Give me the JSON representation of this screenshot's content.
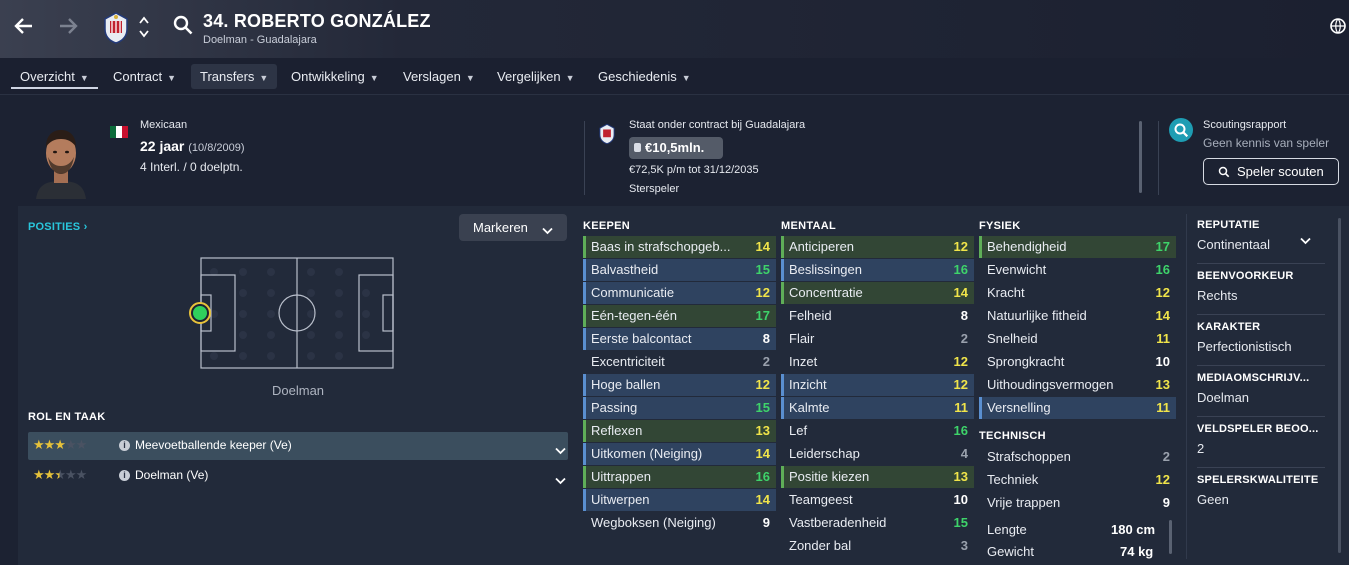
{
  "player": {
    "title": "34. ROBERTO GONZÁLEZ",
    "subtitle": "Doelman - Guadalajara"
  },
  "nav": [
    {
      "label": "Overzicht",
      "key": "overzicht"
    },
    {
      "label": "Contract",
      "key": "contract"
    },
    {
      "label": "Transfers",
      "key": "transfers"
    },
    {
      "label": "Ontwikkeling",
      "key": "ontwikkeling"
    },
    {
      "label": "Verslagen",
      "key": "verslagen"
    },
    {
      "label": "Vergelijken",
      "key": "vergelijken"
    },
    {
      "label": "Geschiedenis",
      "key": "geschiedenis"
    }
  ],
  "info": {
    "nationality": "Mexicaan",
    "age": "22 jaar",
    "birth": "(10/8/2009)",
    "caps": "4 Interl. / 0 doelptn."
  },
  "contract": {
    "status": "Staat onder contract bij Guadalajara",
    "value": "€10,5mln.",
    "wage": "€72,5K p/m tot 31/12/2035",
    "role": "Sterspeler"
  },
  "scout": {
    "title": "Scoutingsrapport",
    "subtitle": "Geen kennis van speler",
    "button": "Speler scouten"
  },
  "positions": {
    "header": "POSITIES",
    "dropdown": "Markeren",
    "position_label": "Doelman"
  },
  "roles": {
    "header": "ROL EN TAAK",
    "items": [
      {
        "name": "Meevoetballende keeper (Ve)",
        "stars": 3
      },
      {
        "name": "Doelman (Ve)",
        "stars": 2.5
      }
    ]
  },
  "keepen": {
    "header": "KEEPEN",
    "items": [
      {
        "n": "Baas in strafschopgeb...",
        "v": "14"
      },
      {
        "n": "Balvastheid",
        "v": "15"
      },
      {
        "n": "Communicatie",
        "v": "12"
      },
      {
        "n": "Eén-tegen-één",
        "v": "17"
      },
      {
        "n": "Eerste balcontact",
        "v": "8"
      },
      {
        "n": "Excentriciteit",
        "v": "2"
      },
      {
        "n": "Hoge ballen",
        "v": "12"
      },
      {
        "n": "Passing",
        "v": "15"
      },
      {
        "n": "Reflexen",
        "v": "13"
      },
      {
        "n": "Uitkomen (Neiging)",
        "v": "14"
      },
      {
        "n": "Uittrappen",
        "v": "16"
      },
      {
        "n": "Uitwerpen",
        "v": "14"
      },
      {
        "n": "Wegboksen (Neiging)",
        "v": "9"
      }
    ]
  },
  "mentaal": {
    "header": "MENTAAL",
    "items": [
      {
        "n": "Anticiperen",
        "v": "12"
      },
      {
        "n": "Beslissingen",
        "v": "16"
      },
      {
        "n": "Concentratie",
        "v": "14"
      },
      {
        "n": "Felheid",
        "v": "8"
      },
      {
        "n": "Flair",
        "v": "2"
      },
      {
        "n": "Inzet",
        "v": "12"
      },
      {
        "n": "Inzicht",
        "v": "12"
      },
      {
        "n": "Kalmte",
        "v": "11"
      },
      {
        "n": "Lef",
        "v": "16"
      },
      {
        "n": "Leiderschap",
        "v": "4"
      },
      {
        "n": "Positie kiezen",
        "v": "13"
      },
      {
        "n": "Teamgeest",
        "v": "10"
      },
      {
        "n": "Vastberadenheid",
        "v": "15"
      },
      {
        "n": "Zonder bal",
        "v": "3"
      }
    ]
  },
  "fysiek": {
    "header": "FYSIEK",
    "items": [
      {
        "n": "Behendigheid",
        "v": "17"
      },
      {
        "n": "Evenwicht",
        "v": "16"
      },
      {
        "n": "Kracht",
        "v": "12"
      },
      {
        "n": "Natuurlijke fitheid",
        "v": "14"
      },
      {
        "n": "Snelheid",
        "v": "11"
      },
      {
        "n": "Sprongkracht",
        "v": "10"
      },
      {
        "n": "Uithoudingsvermogen",
        "v": "13"
      },
      {
        "n": "Versnelling",
        "v": "11"
      }
    ]
  },
  "technisch": {
    "header": "TECHNISCH",
    "items": [
      {
        "n": "Strafschoppen",
        "v": "2"
      },
      {
        "n": "Techniek",
        "v": "12"
      },
      {
        "n": "Vrije trappen",
        "v": "9"
      }
    ]
  },
  "physical": {
    "length_label": "Lengte",
    "length": "180 cm",
    "weight_label": "Gewicht",
    "weight": "74 kg"
  },
  "side": [
    {
      "h": "REPUTATIE",
      "v": "Continentaal"
    },
    {
      "h": "BEENVOORKEUR",
      "v": "Rechts"
    },
    {
      "h": "KARAKTER",
      "v": "Perfectionistisch"
    },
    {
      "h": "MEDIAOMSCHRIJV...",
      "v": "Doelman"
    },
    {
      "h": "VELDSPELER BEOO...",
      "v": "2"
    },
    {
      "h": "SPELERSKWALITEITE",
      "v": "Geen"
    }
  ],
  "colors": {
    "high": "#3ed36a",
    "mid": "#f0e44a",
    "accent": "#2bb5c9"
  }
}
